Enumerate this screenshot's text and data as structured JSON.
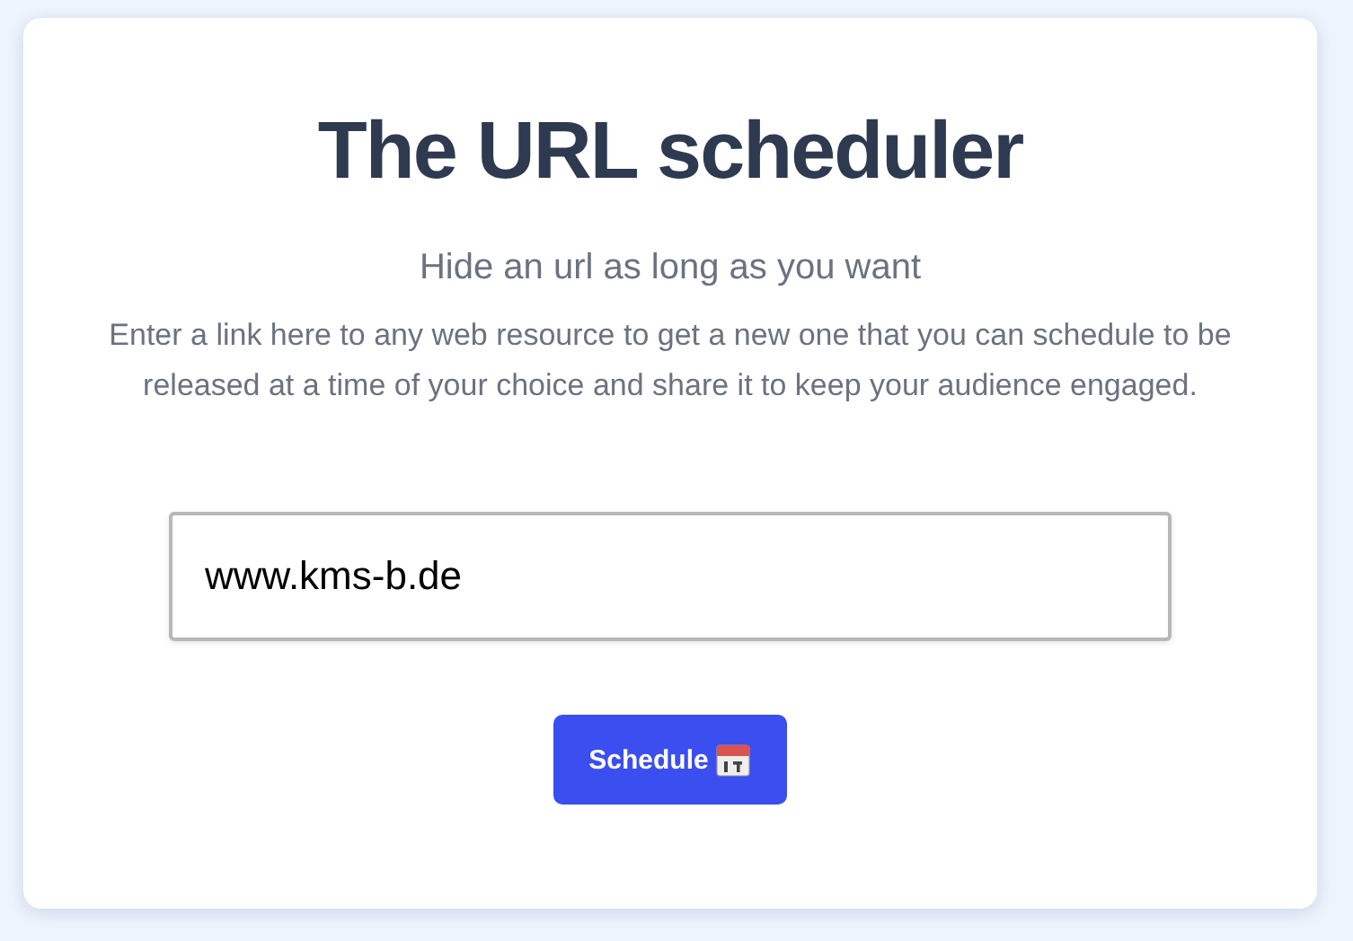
{
  "title": "The URL scheduler",
  "subtitle": "Hide an url as long as you want",
  "description": "Enter a link here to any web resource to get a new one that you can schedule to be released at a time of your choice and share it to keep your audience engaged.",
  "url_field": {
    "value": "www.kms-b.de"
  },
  "button": {
    "label": "Schedule"
  }
}
